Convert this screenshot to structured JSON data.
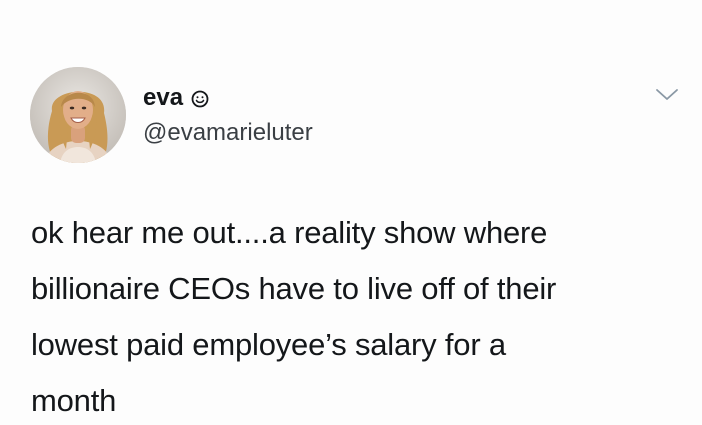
{
  "tweet": {
    "author": {
      "display_name": "eva",
      "name_emoji": "smiley-face-icon",
      "handle": "@evamarieluter",
      "avatar": "profile-photo"
    },
    "text": "ok hear me out....a reality show where\nbillionaire CEOs have to live off of their\nlowest paid employee’s salary for a\nmonth",
    "menu_icon": "chevron-down-icon"
  },
  "colors": {
    "background": "#ffffff",
    "text": "#14171a",
    "secondary_text": "#3a3f44",
    "chevron": "#8a98a5"
  }
}
